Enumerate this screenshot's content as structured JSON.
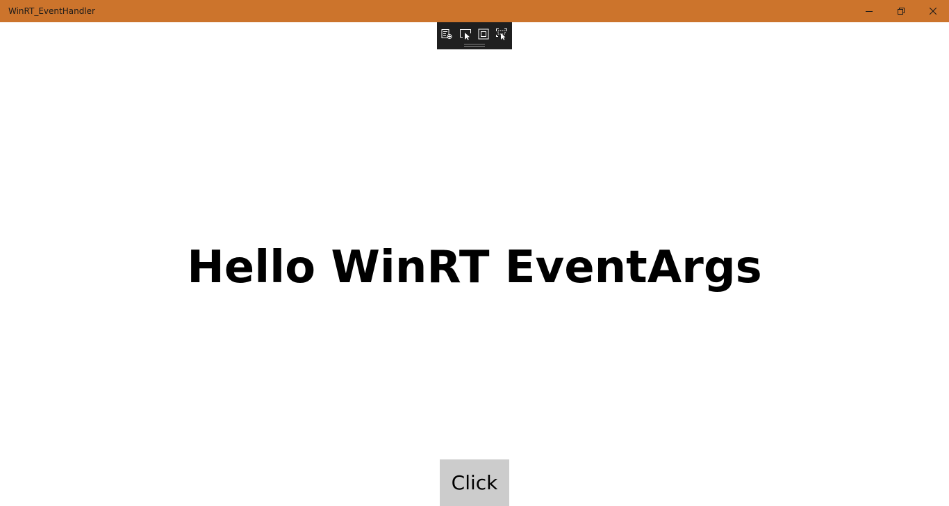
{
  "window": {
    "title": "WinRT_EventHandler",
    "titlebar_color": "#cc742c",
    "background_color": "#ffffff",
    "controls": {
      "minimize_icon": "minimize-icon",
      "restore_icon": "restore-icon",
      "close_icon": "close-icon"
    }
  },
  "debug_toolbar": {
    "background_color": "#1f1f1f",
    "icons": [
      "live-visual-tree-icon",
      "select-element-icon",
      "display-layout-adorners-icon",
      "track-focused-element-icon"
    ]
  },
  "main": {
    "headline": "Hello WinRT EventArgs",
    "button_label": "Click",
    "button_color": "#cccccc"
  }
}
